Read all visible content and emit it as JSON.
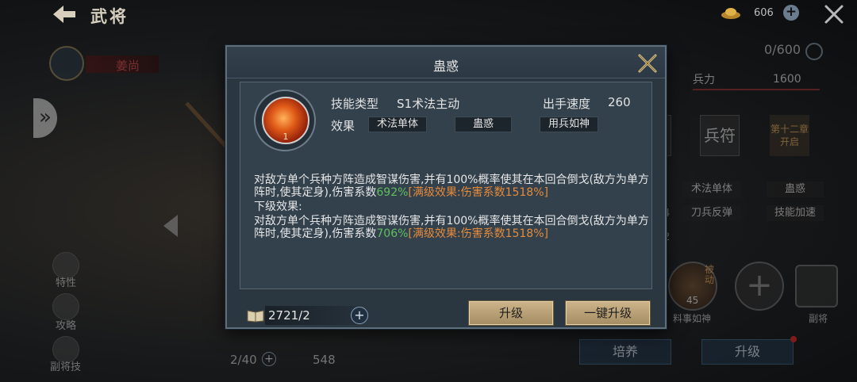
{
  "header": {
    "title": "武将",
    "gold_value": "606"
  },
  "background": {
    "hero_name": "姜尚",
    "troop_count": "0/600",
    "stat_label": "兵力",
    "stat_value": "1600",
    "slot_talisman": "兵符",
    "slot_locked": "第十二章开启",
    "tags": [
      "术法单体",
      "蛊惑",
      "刀兵反弹",
      "技能加速"
    ],
    "left_digit_4": "4",
    "left_digit_2": "2",
    "side_menu": [
      "特性",
      "攻略",
      "副将技"
    ],
    "skill_locked_label": "料事如神",
    "skill_locked_level": "45",
    "skill_locked_tag": "被动",
    "deputy_label": "副将",
    "train_button": "培养",
    "upgrade_button": "升级",
    "fragment_count": "2/40",
    "power_value": "548"
  },
  "modal": {
    "title": "蛊惑",
    "skill_level": "1",
    "type_label": "技能类型",
    "type_value": "S1术法主动",
    "speed_label": "出手速度",
    "speed_value": "260",
    "effect_label": "效果",
    "effect_tags": [
      "术法单体",
      "蛊惑",
      "用兵如神"
    ],
    "desc_part1": "对敌方单个兵种方阵造成智谋伤害,并有100%概率使其在本回合倒戈(敌方为单方阵时,使其定身),伤害系数",
    "desc_coef1": "692%",
    "desc_full1": "[满级效果:伤害系数1518%]",
    "next_label": "下级效果:",
    "desc_part2": "对敌方单个兵种方阵造成智谋伤害,并有100%概率使其在本回合倒戈(敌方为单方阵时,使其定身),伤害系数",
    "desc_coef2": "706%",
    "desc_full2": "[满级效果:伤害系数1518%]",
    "book_count": "2721/2",
    "upgrade_button": "升级",
    "one_key_upgrade_button": "一键升级"
  },
  "colors": {
    "coef_green": "#5fbf5f",
    "full_level_orange": "#e58a3a",
    "button_gold": "#bfa67b"
  }
}
